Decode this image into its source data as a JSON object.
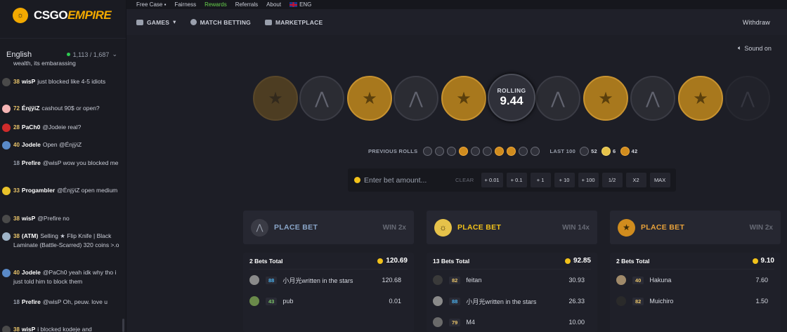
{
  "brand": {
    "part1": "CSGO",
    "part2": "EMPIRE"
  },
  "sidebar": {
    "language": "English",
    "online": "1,113 / 1,687",
    "messages": [
      {
        "avatar_color": "",
        "level": "",
        "user": "",
        "text": "wealth, its embarassing"
      },
      {
        "avatar_color": "#4a4a4a",
        "level": "38",
        "user": "wisP",
        "text": "just blocked like 4-5 idiots"
      },
      {
        "avatar_color": "#f5b5b5",
        "level": "72",
        "user": "ÉnjÿiZ",
        "text": "cashout 90$ or open?"
      },
      {
        "avatar_color": "#d02b2b",
        "level": "28",
        "user": "PaCh0",
        "text": "@Jodeie  real?"
      },
      {
        "avatar_color": "#5a8ac8",
        "level": "40",
        "user": "Jodele",
        "text": "Open  @ÉnjÿiZ"
      },
      {
        "avatar_color": "",
        "level": "18",
        "user": "Prefire",
        "text": "@wisP  wow you blocked me"
      },
      {
        "avatar_color": "#e9c22a",
        "level": "33",
        "user": "Progambler",
        "text": "@ÉnjÿiZ  open medium"
      },
      {
        "avatar_color": "#4a4a4a",
        "level": "38",
        "user": "wisP",
        "text": "@Prefire  no"
      },
      {
        "avatar_color": "#9fb4c8",
        "level": "38",
        "user": "(ATM)",
        "text": "Selling ★ Flip Knife | Black Laminate (Battle-Scarred) 320 coins >.o"
      },
      {
        "avatar_color": "#5a8ac8",
        "level": "40",
        "user": "Jodele",
        "text": "@PaCh0  yeah idk why tho i just told him to block them"
      },
      {
        "avatar_color": "",
        "level": "18",
        "user": "Prefire",
        "text": "@wisP  Oh, peuw. love u"
      },
      {
        "avatar_color": "#4a4a4a",
        "level": "38",
        "user": "wisP",
        "text": "i blocked kodeje and"
      }
    ]
  },
  "topbar": {
    "links": [
      "Free Case",
      "Fairness",
      "Rewards",
      "Referrals",
      "About",
      "ENG"
    ]
  },
  "nav": {
    "games": "GAMES",
    "match_betting": "MATCH BETTING",
    "marketplace": "MARKETPLACE",
    "withdraw": "Withdraw"
  },
  "sound": "Sound on",
  "roll": {
    "label": "ROLLING",
    "value": "9.44"
  },
  "previous": {
    "label": "PREVIOUS ROLLS",
    "last100_label": "LAST 100",
    "ct_count": "52",
    "bonus_count": "6",
    "t_count": "42",
    "rolls": [
      "ct",
      "ct",
      "ct",
      "t",
      "ct",
      "ct",
      "t",
      "t",
      "ct",
      "ct"
    ]
  },
  "bet": {
    "placeholder": "Enter bet amount...",
    "clear": "CLEAR",
    "chips": [
      "+ 0.01",
      "+ 0.1",
      "+ 1",
      "+ 10",
      "+ 100",
      "1/2",
      "X2",
      "MAX"
    ]
  },
  "panels": [
    {
      "title": "PLACE BET",
      "win": "WIN 2x",
      "title_color": "#8aa6c9",
      "icon_color": "#3a3b45",
      "total_label": "2 Bets Total",
      "total": "120.69",
      "bets": [
        {
          "level": "88",
          "level_color": "blue",
          "user": "小月光written in the stars",
          "amount": "120.68",
          "avatar_color": "#8a8a8a"
        },
        {
          "level": "43",
          "level_color": "green",
          "user": "pub",
          "amount": "0.01",
          "avatar_color": "#6a8a4a"
        }
      ]
    },
    {
      "title": "PLACE BET",
      "win": "WIN 14x",
      "title_color": "#f2c21a",
      "icon_color": "#e6c24a",
      "total_label": "13 Bets Total",
      "total": "92.85",
      "bets": [
        {
          "level": "82",
          "level_color": "gold",
          "user": "feitan",
          "amount": "30.93",
          "avatar_color": "#3a3a3a"
        },
        {
          "level": "88",
          "level_color": "blue",
          "user": "小月光written in the stars",
          "amount": "26.33",
          "avatar_color": "#8a8a8a"
        },
        {
          "level": "79",
          "level_color": "gold",
          "user": "M4",
          "amount": "10.00",
          "avatar_color": "#6a6a6a"
        }
      ]
    },
    {
      "title": "PLACE BET",
      "win": "WIN 2x",
      "title_color": "#e8a23a",
      "icon_color": "#d08c1e",
      "total_label": "2 Bets Total",
      "total": "9.10",
      "bets": [
        {
          "level": "40",
          "level_color": "gold",
          "user": "Hakuna",
          "amount": "7.60",
          "avatar_color": "#a08a6a"
        },
        {
          "level": "82",
          "level_color": "gold",
          "user": "Muichiro",
          "amount": "1.50",
          "avatar_color": "#2a2a2a"
        }
      ]
    }
  ]
}
